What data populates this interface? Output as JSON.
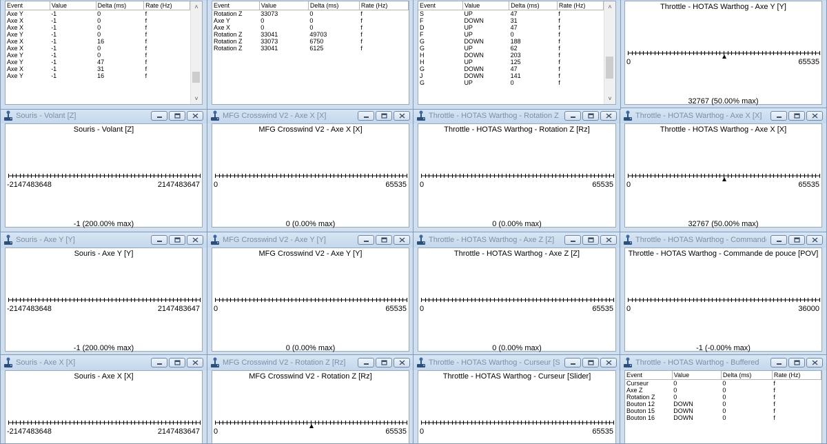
{
  "table_windows": [
    {
      "title": "",
      "columns": [
        "Event",
        "Value",
        "Delta (ms)",
        "Rate (Hz)"
      ],
      "rows": [
        [
          "Axe Y",
          "-1",
          "0",
          "f"
        ],
        [
          "Axe X",
          "-1",
          "0",
          "f"
        ],
        [
          "Axe X",
          "-1",
          "0",
          "f"
        ],
        [
          "Axe Y",
          "-1",
          "0",
          "f"
        ],
        [
          "Axe X",
          "-1",
          "16",
          "f"
        ],
        [
          "Axe X",
          "-1",
          "0",
          "f"
        ],
        [
          "Axe Y",
          "-1",
          "0",
          "f"
        ],
        [
          "Axe Y",
          "-1",
          "47",
          "f"
        ],
        [
          "Axe X",
          "-1",
          "31",
          "f"
        ],
        [
          "Axe Y",
          "-1",
          "16",
          "f"
        ]
      ]
    },
    {
      "title": "",
      "columns": [
        "Event",
        "Value",
        "Delta (ms)",
        "Rate (Hz)"
      ],
      "rows": [
        [
          "Rotation Z",
          "33073",
          "0",
          "f"
        ],
        [
          "Axe Y",
          "0",
          "0",
          "f"
        ],
        [
          "Axe X",
          "0",
          "0",
          "f"
        ],
        [
          "Rotation Z",
          "33041",
          "49703",
          "f"
        ],
        [
          "Rotation Z",
          "33073",
          "6750",
          "f"
        ],
        [
          "Rotation Z",
          "33041",
          "6125",
          "f"
        ]
      ]
    },
    {
      "title": "",
      "columns": [
        "Event",
        "Value",
        "Delta (ms)",
        "Rate (Hz)"
      ],
      "rows": [
        [
          "S",
          "UP",
          "47",
          "f"
        ],
        [
          "F",
          "DOWN",
          "31",
          "f"
        ],
        [
          "D",
          "UP",
          "47",
          "f"
        ],
        [
          "F",
          "UP",
          "0",
          "f"
        ],
        [
          "G",
          "DOWN",
          "188",
          "f"
        ],
        [
          "G",
          "UP",
          "62",
          "f"
        ],
        [
          "H",
          "DOWN",
          "203",
          "f"
        ],
        [
          "H",
          "UP",
          "125",
          "f"
        ],
        [
          "G",
          "DOWN",
          "47",
          "f"
        ],
        [
          "J",
          "DOWN",
          "141",
          "f"
        ],
        [
          "G",
          "UP",
          "0",
          "f"
        ]
      ]
    },
    {
      "title": "Throttle - HOTAS Warthog - Buffered",
      "columns": [
        "Event",
        "Value",
        "Delta (ms)",
        "Rate (Hz)"
      ],
      "rows": [
        [
          "Curseur",
          "0",
          "0",
          "f"
        ],
        [
          "Axe Z",
          "0",
          "0",
          "f"
        ],
        [
          "Rotation Z",
          "0",
          "0",
          "f"
        ],
        [
          "Bouton 12",
          "DOWN",
          "0",
          "f"
        ],
        [
          "Bouton 15",
          "DOWN",
          "0",
          "f"
        ],
        [
          "Bouton 16",
          "DOWN",
          "0",
          "f"
        ]
      ]
    }
  ],
  "axis_windows": [
    {
      "title": "",
      "panel": "Throttle - HOTAS Warthog - Axe Y [Y]",
      "min": "0",
      "max": "65535",
      "status": "32767 (50.00% max)",
      "marker": 0.5
    },
    {
      "title": "Souris - Volant [Z]",
      "panel": "Souris - Volant [Z]",
      "min": "-2147483648",
      "max": "2147483647",
      "status": "-1 (200.00% max)",
      "marker": null
    },
    {
      "title": "MFG Crosswind V2 - Axe X [X]",
      "panel": "MFG Crosswind V2 - Axe X [X]",
      "min": "0",
      "max": "65535",
      "status": "0 (0.00% max)",
      "marker": null
    },
    {
      "title": "Throttle - HOTAS Warthog - Rotation Z [Rz]",
      "panel": "Throttle - HOTAS Warthog - Rotation Z [Rz]",
      "min": "0",
      "max": "65535",
      "status": "0 (0.00% max)",
      "marker": null
    },
    {
      "title": "Throttle - HOTAS Warthog - Axe X [X]",
      "panel": "Throttle - HOTAS Warthog - Axe X [X]",
      "min": "0",
      "max": "65535",
      "status": "32767 (50.00% max)",
      "marker": 0.5
    },
    {
      "title": "Souris - Axe Y [Y]",
      "panel": "Souris - Axe Y [Y]",
      "min": "-2147483648",
      "max": "2147483647",
      "status": "-1 (200.00% max)",
      "marker": null
    },
    {
      "title": "MFG Crosswind V2 - Axe Y [Y]",
      "panel": "MFG Crosswind V2 - Axe Y [Y]",
      "min": "0",
      "max": "65535",
      "status": "0 (0.00% max)",
      "marker": null
    },
    {
      "title": "Throttle - HOTAS Warthog - Axe Z [Z]",
      "panel": "Throttle - HOTAS Warthog - Axe Z [Z]",
      "min": "0",
      "max": "65535",
      "status": "0 (0.00% max)",
      "marker": null
    },
    {
      "title": "Throttle - HOTAS Warthog - Commande de p...",
      "panel": "Throttle - HOTAS Warthog - Commande de pouce [POV]",
      "min": "0",
      "max": "36000",
      "status": "-1 (-0.00% max)",
      "marker": null
    },
    {
      "title": "Souris - Axe X [X]",
      "panel": "Souris - Axe X [X]",
      "min": "-2147483648",
      "max": "2147483647",
      "status": "",
      "marker": null
    },
    {
      "title": "MFG Crosswind V2 - Rotation Z [Rz]",
      "panel": "MFG Crosswind V2 - Rotation Z [Rz]",
      "min": "0",
      "max": "65535",
      "status": "",
      "marker": 0.5
    },
    {
      "title": "Throttle - HOTAS Warthog - Curseur [Slider]",
      "panel": "Throttle - HOTAS Warthog - Curseur [Slider]",
      "min": "0",
      "max": "65535",
      "status": "",
      "marker": null
    }
  ],
  "icons": {
    "window_icon": "joystick-icon",
    "minimize": "minimize-icon",
    "maximize": "maximize-icon",
    "close": "close-icon"
  },
  "colors": {
    "desktop": "#b9d1ea",
    "frame": "#cfdff0",
    "title_text": "#7b8fa6",
    "close_red": "#c9463d"
  }
}
